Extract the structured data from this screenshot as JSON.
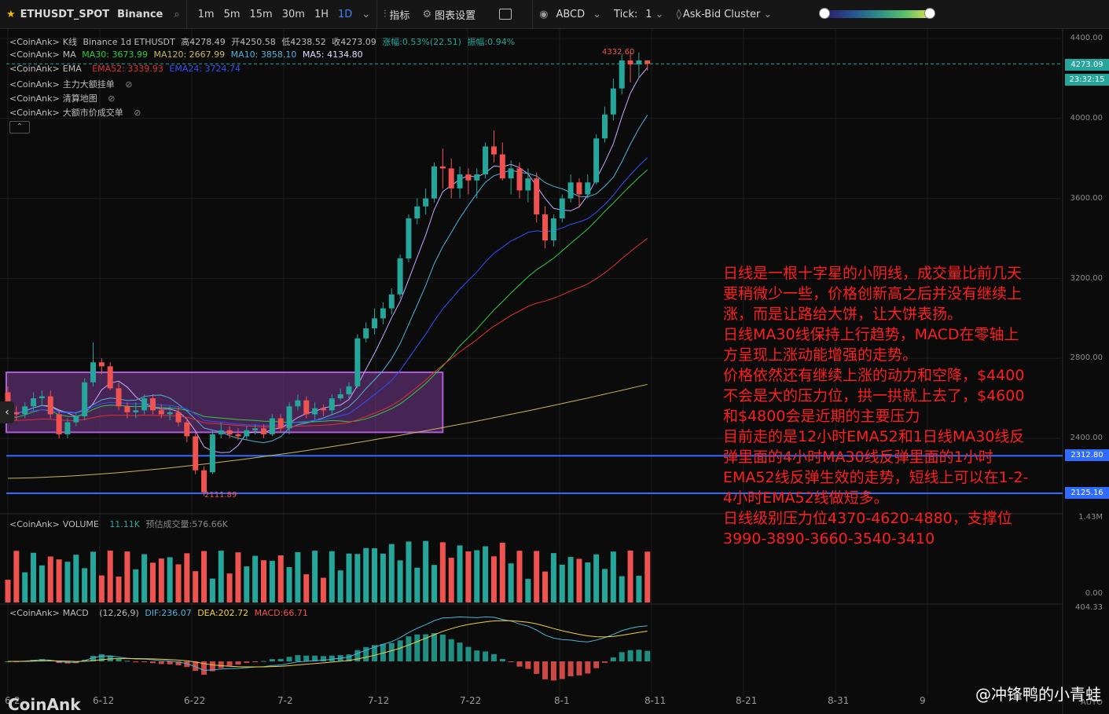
{
  "toolbar": {
    "symbol": "ETHUSDT_SPOT",
    "exchange": "Binance",
    "timeframes": [
      "1m",
      "5m",
      "15m",
      "30m",
      "1H",
      "1D"
    ],
    "active_timeframe": "1D",
    "indicators_label": "指标",
    "chart_settings_label": "图表设置",
    "abcd_label": "ABCD",
    "tick_label": "Tick:",
    "tick_value": "1",
    "cluster_label": "Ask-Bid Cluster"
  },
  "legend": {
    "kline": {
      "src": "<CoinAnk>",
      "name": "K线",
      "info": "Binance 1d ETHUSDT",
      "high": "高4278.49",
      "open": "开4250.58",
      "low": "低4238.52",
      "close": "收4273.09",
      "change": "涨幅:0.53%(22.51)",
      "amp": "振幅:0.94%"
    },
    "ma": {
      "src": "<CoinAnk>",
      "name": "MA",
      "ma30": "MA30: 3673.99",
      "ma120": "MA120: 2667.99",
      "ma10": "MA10: 3858.10",
      "ma5": "MA5: 4134.80"
    },
    "ema": {
      "src": "<CoinAnk>",
      "name": "EMA",
      "ema52": "EMA52: 3339.93",
      "ema24": "EMA24: 3724.74"
    },
    "l4": {
      "src": "<CoinAnk>",
      "name": "主力大额挂单"
    },
    "l5": {
      "src": "<CoinAnk>",
      "name": "清算地图"
    },
    "l6": {
      "src": "<CoinAnk>",
      "name": "大额市价成交单"
    }
  },
  "price_axis": [
    "4400.00",
    "4000.00",
    "3600.00",
    "3200.00",
    "2800.00",
    "2400.00"
  ],
  "last_price": "4273.09",
  "countdown": "23:32:15",
  "level1": "2312.80",
  "level2": "2125.16",
  "high_label": "4332.60",
  "low_label": "2111.89",
  "volume": {
    "src": "<CoinAnk>",
    "name": "VOLUME",
    "value": "11.11K",
    "est": "预估成交量:576.66K",
    "axis_top": "1.43M",
    "axis_bottom": "0.00"
  },
  "macd": {
    "src": "<CoinAnk>",
    "name": "MACD",
    "params": "(12,26,9)",
    "dif": "DIF:236.07",
    "dea": "DEA:202.72",
    "macd": "MACD:66.71",
    "axis_top": "404.33",
    "axis_bottom": "AUTO"
  },
  "x_axis": [
    "6-2",
    "6-12",
    "6-22",
    "7-2",
    "7-12",
    "7-22",
    "8-1",
    "8-11",
    "8-21",
    "8-31",
    "9"
  ],
  "watermark": "CoinAnk",
  "footer": "@冲锋鸭的小青蛙",
  "note": [
    "日线是一根十字星的小阴线，成交量比前几天要稍微少一些，价格创新高之后并没有继续上涨，而是让路给大饼，让大饼表扬。",
    "日线MA30线保持上行趋势，MACD在零轴上方呈现上涨动能增强的走势。",
    "价格依然还有继续上涨的动力和空降，$4400不会是大的压力位，拱一拱就上去了，$4600和$4800会是近期的主要压力",
    "目前走的是12小时EMA52和1日线MA30线反弹里面的4小时MA30线反弹里面的1小时EMA52线反弹生效的走势，短线上可以在1-2-4小时EMA52线做短多。",
    "日线级别压力位4370-4620-4880，支撑位3990-3890-3660-3540-3410"
  ],
  "colors": {
    "up": "#26a69a",
    "down": "#ef5350",
    "ma5": "#c9a7ff",
    "ma10": "#4fb3d9",
    "ma30": "#2ecc40",
    "ma120": "#c8b560",
    "ema52": "#e03030",
    "ema24": "#3050ff",
    "box": "#8e44ad",
    "hline": "#2f6bff"
  },
  "chart_data": {
    "type": "candlestick",
    "dates": [
      "5-30",
      "5-31",
      "6-1",
      "6-2",
      "6-3",
      "6-4",
      "6-5",
      "6-6",
      "6-7",
      "6-8",
      "6-9",
      "6-10",
      "6-11",
      "6-12",
      "6-13",
      "6-14",
      "6-15",
      "6-16",
      "6-17",
      "6-18",
      "6-19",
      "6-20",
      "6-21",
      "6-22",
      "6-23",
      "6-24",
      "6-25",
      "6-26",
      "6-27",
      "6-28",
      "6-29",
      "6-30",
      "7-1",
      "7-2",
      "7-3",
      "7-4",
      "7-5",
      "7-6",
      "7-7",
      "7-8",
      "7-9",
      "7-10",
      "7-11",
      "7-12",
      "7-13",
      "7-14",
      "7-15",
      "7-16",
      "7-17",
      "7-18",
      "7-19",
      "7-20",
      "7-21",
      "7-22",
      "7-23",
      "7-24",
      "7-25",
      "7-26",
      "7-27",
      "7-28",
      "7-29",
      "7-30",
      "7-31",
      "8-1",
      "8-2",
      "8-3",
      "8-4",
      "8-5",
      "8-6",
      "8-7",
      "8-8",
      "8-9",
      "8-10",
      "8-11",
      "8-12",
      "8-13"
    ],
    "open": [
      2630,
      2530,
      2520,
      2560,
      2600,
      2610,
      2520,
      2420,
      2480,
      2510,
      2680,
      2780,
      2760,
      2650,
      2560,
      2530,
      2540,
      2600,
      2540,
      2520,
      2530,
      2480,
      2410,
      2240,
      2230,
      2420,
      2440,
      2420,
      2410,
      2440,
      2450,
      2420,
      2500,
      2450,
      2560,
      2590,
      2520,
      2550,
      2540,
      2600,
      2620,
      2660,
      2900,
      2950,
      3000,
      3050,
      3120,
      3300,
      3500,
      3560,
      3600,
      3760,
      3750,
      3650,
      3720,
      3690,
      3720,
      3860,
      3820,
      3700,
      3750,
      3640,
      3700,
      3520,
      3390,
      3500,
      3600,
      3680,
      3620,
      3680,
      3900,
      4020,
      4150,
      4290,
      4270,
      4290
    ],
    "close": [
      2530,
      2520,
      2560,
      2600,
      2610,
      2520,
      2420,
      2480,
      2510,
      2680,
      2780,
      2760,
      2650,
      2560,
      2530,
      2540,
      2600,
      2540,
      2520,
      2530,
      2480,
      2410,
      2240,
      2130,
      2420,
      2440,
      2420,
      2410,
      2440,
      2450,
      2420,
      2500,
      2450,
      2560,
      2590,
      2520,
      2550,
      2540,
      2600,
      2620,
      2660,
      2900,
      2950,
      3000,
      3050,
      3120,
      3300,
      3500,
      3560,
      3600,
      3760,
      3750,
      3650,
      3720,
      3690,
      3720,
      3860,
      3820,
      3700,
      3750,
      3640,
      3700,
      3520,
      3390,
      3500,
      3600,
      3680,
      3620,
      3680,
      3900,
      4020,
      4150,
      4290,
      4270,
      4290,
      4273.09
    ],
    "high": [
      2660,
      2560,
      2580,
      2630,
      2640,
      2640,
      2540,
      2500,
      2530,
      2700,
      2880,
      2800,
      2780,
      2680,
      2580,
      2580,
      2620,
      2620,
      2570,
      2560,
      2560,
      2500,
      2430,
      2260,
      2440,
      2480,
      2460,
      2450,
      2460,
      2470,
      2470,
      2520,
      2520,
      2580,
      2620,
      2610,
      2580,
      2570,
      2620,
      2650,
      2680,
      2920,
      2980,
      3050,
      3080,
      3150,
      3320,
      3520,
      3600,
      3650,
      3780,
      3850,
      3800,
      3760,
      3750,
      3750,
      3880,
      3940,
      3880,
      3790,
      3780,
      3750,
      3730,
      3560,
      3520,
      3620,
      3720,
      3700,
      3720,
      3920,
      4060,
      4200,
      4320,
      4332.6,
      4330,
      4278.49
    ],
    "low": [
      2500,
      2490,
      2500,
      2540,
      2560,
      2500,
      2400,
      2400,
      2460,
      2490,
      2660,
      2720,
      2640,
      2540,
      2500,
      2500,
      2520,
      2520,
      2500,
      2490,
      2460,
      2380,
      2220,
      2111.89,
      2220,
      2400,
      2400,
      2390,
      2390,
      2420,
      2400,
      2410,
      2430,
      2420,
      2540,
      2500,
      2490,
      2510,
      2520,
      2590,
      2600,
      2650,
      2880,
      2920,
      2970,
      3020,
      3100,
      3280,
      3470,
      3520,
      3580,
      3650,
      3600,
      3600,
      3620,
      3600,
      3700,
      3780,
      3690,
      3620,
      3600,
      3580,
      3480,
      3350,
      3360,
      3480,
      3580,
      3560,
      3600,
      3670,
      3880,
      3990,
      4120,
      4180,
      4200,
      4238.52
    ],
    "volume_scale": [
      0.1,
      1.43
    ]
  }
}
